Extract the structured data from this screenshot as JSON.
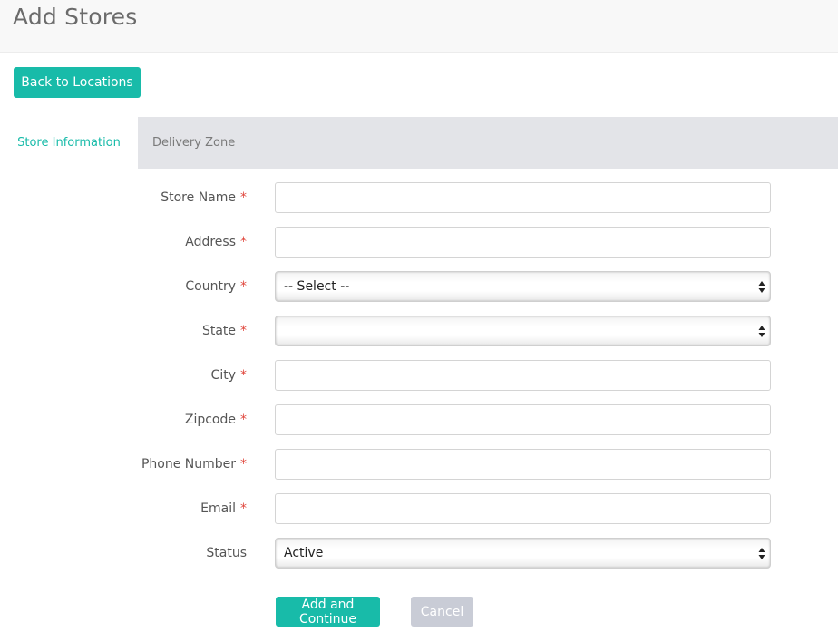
{
  "header": {
    "title": "Add Stores"
  },
  "back_button": {
    "label": "Back to Locations"
  },
  "tabs": [
    {
      "label": "Store Information",
      "active": true
    },
    {
      "label": "Delivery Zone",
      "active": false
    }
  ],
  "form": {
    "required_mark": "*",
    "fields": {
      "store_name": {
        "label": "Store Name",
        "value": ""
      },
      "address": {
        "label": "Address",
        "value": ""
      },
      "country": {
        "label": "Country",
        "selected": "-- Select --"
      },
      "state": {
        "label": "State",
        "selected": ""
      },
      "city": {
        "label": "City",
        "value": ""
      },
      "zipcode": {
        "label": "Zipcode",
        "value": ""
      },
      "phone": {
        "label": "Phone Number",
        "value": ""
      },
      "email": {
        "label": "Email",
        "value": ""
      },
      "status": {
        "label": "Status",
        "selected": "Active"
      }
    }
  },
  "actions": {
    "submit_label": "Add and Continue",
    "cancel_label": "Cancel"
  },
  "colors": {
    "accent": "#18bba9",
    "required": "#e0463c",
    "tab_inactive_bg": "#e3e4e8",
    "cancel_bg": "#c9ccd6"
  }
}
